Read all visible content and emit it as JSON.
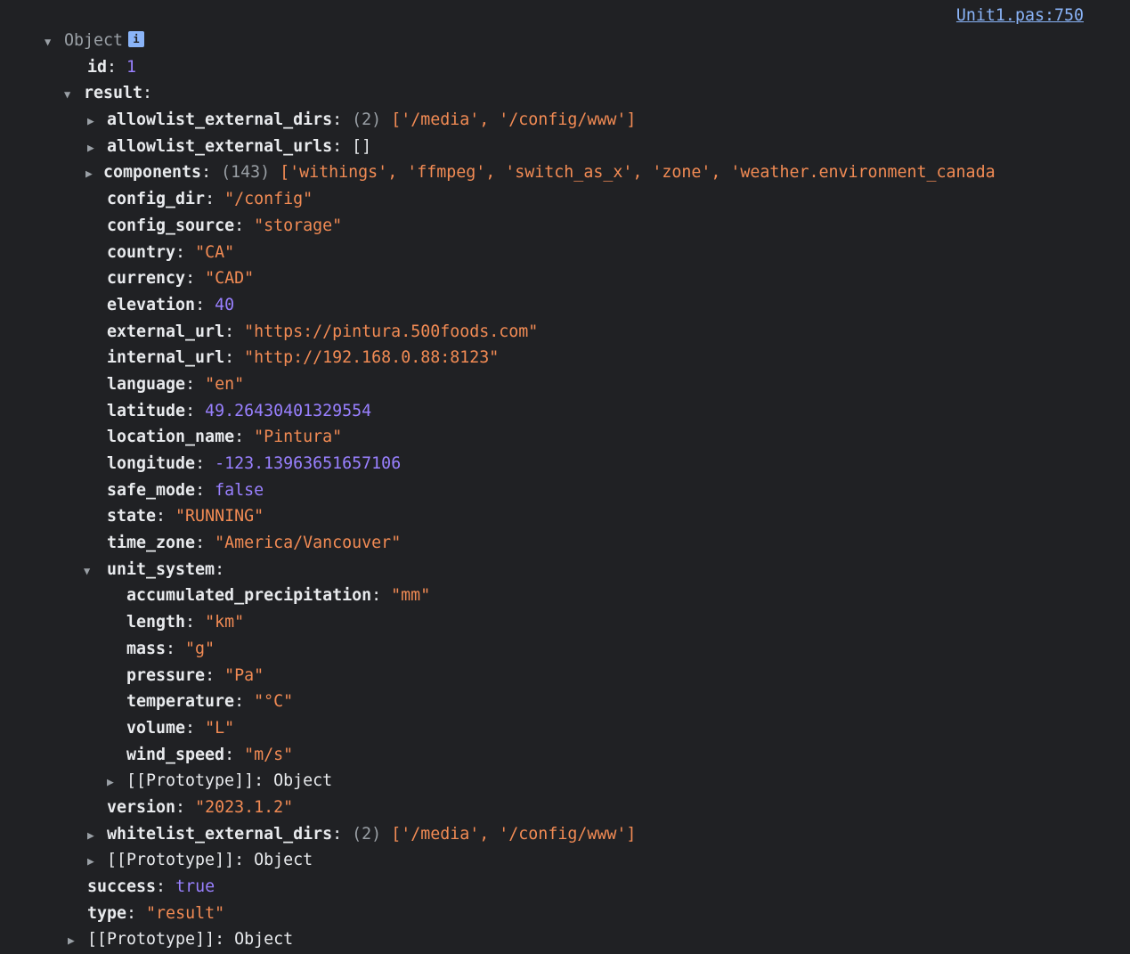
{
  "source_link": "Unit1.pas:750",
  "root": {
    "label": "Object",
    "info_badge": "i",
    "id_key": "id",
    "id_value": "1",
    "result_key": "result",
    "success_key": "success",
    "success_value": "true",
    "type_key": "type",
    "type_value": "\"result\"",
    "proto_key": "[[Prototype]]",
    "proto_value": "Object"
  },
  "result": {
    "allowlist_dirs": {
      "key": "allowlist_external_dirs",
      "count": "(2)",
      "preview": "['/media', '/config/www']"
    },
    "allowlist_urls": {
      "key": "allowlist_external_urls",
      "preview": "[]"
    },
    "components": {
      "key": "components",
      "count": "(143)",
      "preview": "['withings', 'ffmpeg', 'switch_as_x', 'zone', 'weather.environment_canada"
    },
    "fields": [
      {
        "key": "config_dir",
        "value": "\"/config\"",
        "kind": "str"
      },
      {
        "key": "config_source",
        "value": "\"storage\"",
        "kind": "str"
      },
      {
        "key": "country",
        "value": "\"CA\"",
        "kind": "str"
      },
      {
        "key": "currency",
        "value": "\"CAD\"",
        "kind": "str"
      },
      {
        "key": "elevation",
        "value": "40",
        "kind": "num"
      },
      {
        "key": "external_url",
        "value": "\"https://pintura.500foods.com\"",
        "kind": "str"
      },
      {
        "key": "internal_url",
        "value": "\"http://192.168.0.88:8123\"",
        "kind": "str"
      },
      {
        "key": "language",
        "value": "\"en\"",
        "kind": "str"
      },
      {
        "key": "latitude",
        "value": "49.26430401329554",
        "kind": "num"
      },
      {
        "key": "location_name",
        "value": "\"Pintura\"",
        "kind": "str"
      },
      {
        "key": "longitude",
        "value": "-123.13963651657106",
        "kind": "num"
      },
      {
        "key": "safe_mode",
        "value": "false",
        "kind": "num"
      },
      {
        "key": "state",
        "value": "\"RUNNING\"",
        "kind": "str"
      },
      {
        "key": "time_zone",
        "value": "\"America/Vancouver\"",
        "kind": "str"
      }
    ],
    "unit_system_key": "unit_system",
    "unit_system": [
      {
        "key": "accumulated_precipitation",
        "value": "\"mm\""
      },
      {
        "key": "length",
        "value": "\"km\""
      },
      {
        "key": "mass",
        "value": "\"g\""
      },
      {
        "key": "pressure",
        "value": "\"Pa\""
      },
      {
        "key": "temperature",
        "value": "\"°C\""
      },
      {
        "key": "volume",
        "value": "\"L\""
      },
      {
        "key": "wind_speed",
        "value": "\"m/s\""
      }
    ],
    "unit_proto_key": "[[Prototype]]",
    "unit_proto_value": "Object",
    "version_key": "version",
    "version_value": "\"2023.1.2\"",
    "whitelist_dirs": {
      "key": "whitelist_external_dirs",
      "count": "(2)",
      "preview": "['/media', '/config/www']"
    },
    "result_proto_key": "[[Prototype]]",
    "result_proto_value": "Object"
  },
  "colors": {
    "background": "#202124",
    "key": "#e8eaed",
    "string": "#f28b54",
    "number": "#9980ff",
    "link": "#8ab4f8",
    "muted": "#9aa0a6"
  },
  "icons": {
    "expanded": "triangle-down-icon",
    "collapsed": "triangle-right-icon",
    "info": "info-icon"
  }
}
